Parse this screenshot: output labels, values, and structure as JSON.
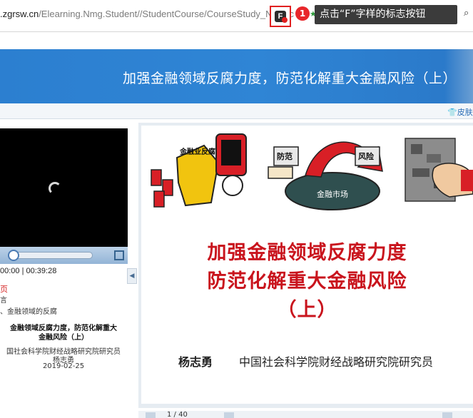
{
  "address_bar": {
    "domain": ".zgrsw.cn",
    "path": "/Elearning.Nmg.Student//StudentCourse/CourseStudy_New?c",
    "extension_letter": "F",
    "step_number": "1",
    "tooltip": "点击“F”字样的标志按钮"
  },
  "course": {
    "banner_title": "加强金融领域反腐力度，防范化解重大金融风险（上）",
    "skin_link": "皮肤"
  },
  "player": {
    "time": "00:00 | 00:39:28"
  },
  "lesson_list": {
    "item_red": "页",
    "item1": "言",
    "item2": "、金融领域的反腐",
    "bold_line1": "金融领域反腐力度，防范化解重大",
    "bold_line2": "金融风险（上）",
    "org": "国社会科学院财经战略研究院研究员",
    "author": "杨志勇",
    "date": "2019-02-25"
  },
  "slide": {
    "title_line1": "加强金融领域反腐力度",
    "title_line2": "防范化解重大金融风险",
    "title_line3": "（上）",
    "author": "杨志勇",
    "org": "中国社会科学院财经战略研究院研究员",
    "illus_label1": "金融业反腐",
    "illus_label2": "防范",
    "illus_label3": "风险",
    "illus_label4": "金融市场"
  },
  "pager": {
    "text": "1  /  40"
  },
  "colors": {
    "banner_blue": "#2f85d5",
    "title_red": "#c9141d",
    "badge_red": "#e8262a"
  }
}
